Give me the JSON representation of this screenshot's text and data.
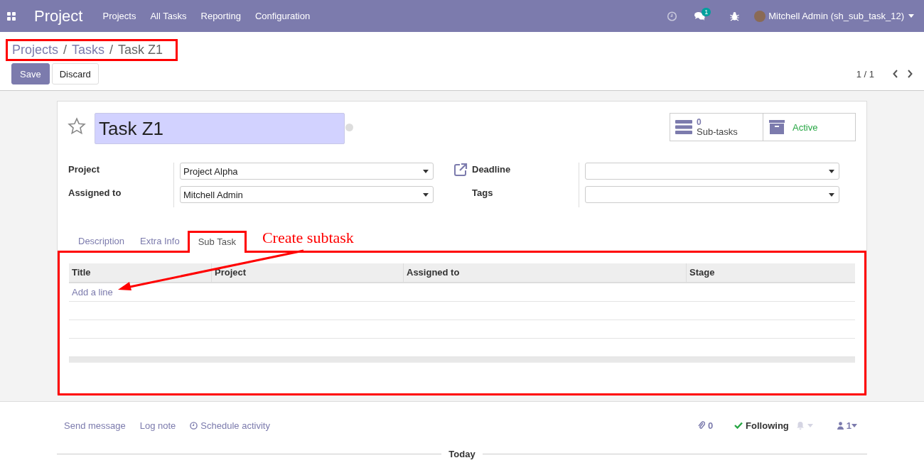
{
  "navbar": {
    "app_name": "Project",
    "menu": [
      "Projects",
      "All Tasks",
      "Reporting",
      "Configuration"
    ],
    "messages_badge": "1",
    "user": "Mitchell Admin (sh_sub_task_12)"
  },
  "breadcrumb": {
    "separator": "/",
    "items": [
      {
        "label": "Projects",
        "link": true
      },
      {
        "label": "Tasks",
        "link": true
      },
      {
        "label": "Task Z1",
        "link": false
      }
    ]
  },
  "buttons": [
    {
      "label": "Save",
      "kind": "primary"
    },
    {
      "label": "Discard",
      "kind": "secondary"
    }
  ],
  "pager": "1 / 1",
  "form": {
    "title": "Task Z1",
    "starred": false,
    "smart_buttons": [
      {
        "kind": "count",
        "value": "0",
        "label": "Sub-tasks"
      },
      {
        "kind": "toggle",
        "label": "Active"
      }
    ],
    "left_fields": [
      {
        "label": "Project",
        "value": "Project Alpha"
      },
      {
        "label": "Assigned to",
        "value": "Mitchell Admin"
      }
    ],
    "right_fields": [
      {
        "label": "Deadline",
        "link_icon": true
      },
      {
        "label": "Tags",
        "link_icon": false
      }
    ],
    "tabs": [
      {
        "label": "Description",
        "selected": false
      },
      {
        "label": "Extra Info",
        "selected": false
      },
      {
        "label": "Sub Task",
        "selected": true
      }
    ],
    "table": {
      "columns": [
        "Title",
        "Project",
        "Assigned to",
        "Stage"
      ],
      "add_line": "Add a line"
    }
  },
  "annotation": "Create subtask",
  "chatter": {
    "actions": [
      "Send message",
      "Log note",
      "Schedule activity"
    ],
    "attachments": "0",
    "follow": "Following",
    "followers": "1",
    "divider": "Today"
  }
}
